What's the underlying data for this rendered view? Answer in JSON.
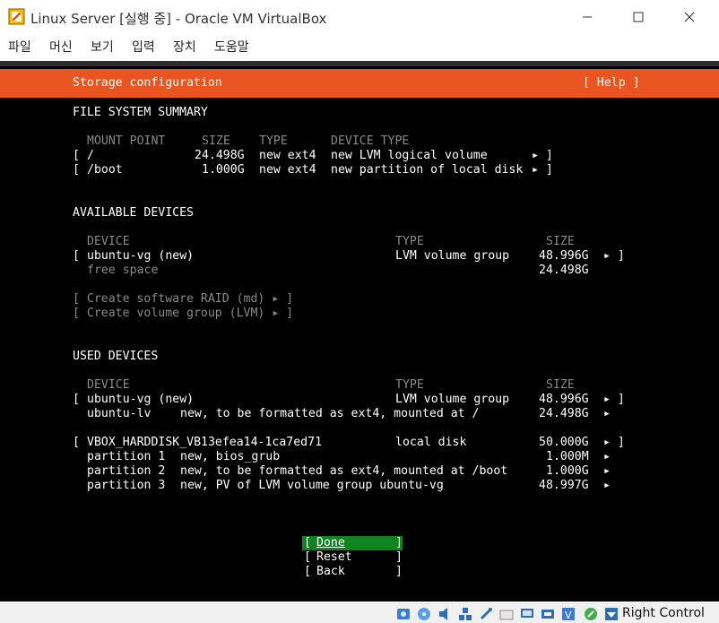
{
  "window": {
    "title": "Linux Server [실행 중] - Oracle VM VirtualBox",
    "menu": [
      "파일",
      "머신",
      "보기",
      "입력",
      "장치",
      "도움말"
    ]
  },
  "header": {
    "title": "Storage configuration",
    "help": "[ Help ]"
  },
  "fs_summary": {
    "title": "FILE SYSTEM SUMMARY",
    "headers": [
      "MOUNT POINT",
      "SIZE",
      "TYPE",
      "DEVICE TYPE"
    ],
    "rows": [
      {
        "mount": "/",
        "size": "24.498G",
        "type": "new ext4",
        "device_type": "new LVM logical volume"
      },
      {
        "mount": "/boot",
        "size": "1.000G",
        "type": "new ext4",
        "device_type": "new partition of local disk"
      }
    ]
  },
  "available": {
    "title": "AVAILABLE DEVICES",
    "headers": [
      "DEVICE",
      "TYPE",
      "SIZE"
    ],
    "rows": [
      {
        "device": "ubuntu-vg (new)",
        "type": "LVM volume group",
        "size": "48.996G"
      },
      {
        "device": "free space",
        "type": "",
        "size": "24.498G"
      }
    ],
    "actions": [
      "[ Create software RAID (md) ▸ ]",
      "[ Create volume group (LVM) ▸ ]"
    ]
  },
  "used": {
    "title": "USED DEVICES",
    "headers": [
      "DEVICE",
      "TYPE",
      "SIZE"
    ],
    "rows": [
      {
        "device": "ubuntu-vg (new)",
        "type": "LVM volume group",
        "size": "48.996G"
      },
      {
        "device": "ubuntu-lv",
        "type": "new, to be formatted as ext4, mounted at /",
        "size": "24.498G"
      },
      {
        "device": "VBOX_HARDDISK_VB13efea14-1ca7ed71",
        "type": "local disk",
        "size": "50.000G"
      },
      {
        "device": "partition 1",
        "type": "new, bios_grub",
        "size": "1.000M"
      },
      {
        "device": "partition 2",
        "type": "new, to be formatted as ext4, mounted at /boot",
        "size": "1.000G"
      },
      {
        "device": "partition 3",
        "type": "new, PV of LVM volume group ubuntu-vg",
        "size": "48.997G"
      }
    ]
  },
  "buttons": {
    "done": "Done",
    "reset": "Reset",
    "back": "Back"
  },
  "statusbar": {
    "host_key": "Right Control"
  },
  "colors": {
    "accent": "#e95420",
    "selected": "#0e8420"
  }
}
